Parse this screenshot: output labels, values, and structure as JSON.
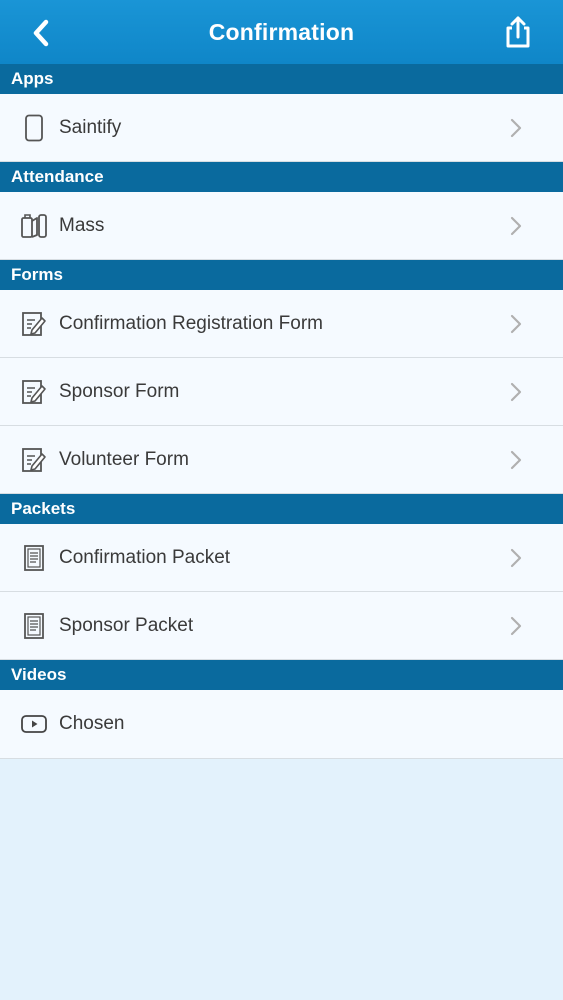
{
  "header": {
    "title": "Confirmation",
    "back_icon": "chevron-left-icon",
    "share_icon": "share-icon"
  },
  "sections": [
    {
      "title": "Apps",
      "items": [
        {
          "label": "Saintify",
          "icon": "phone-icon",
          "has_chevron": true
        }
      ]
    },
    {
      "title": "Attendance",
      "items": [
        {
          "label": "Mass",
          "icon": "attendance-icon",
          "has_chevron": true
        }
      ]
    },
    {
      "title": "Forms",
      "items": [
        {
          "label": "Confirmation Registration Form",
          "icon": "form-edit-icon",
          "has_chevron": true
        },
        {
          "label": "Sponsor Form",
          "icon": "form-edit-icon",
          "has_chevron": true
        },
        {
          "label": "Volunteer Form",
          "icon": "form-edit-icon",
          "has_chevron": true
        }
      ]
    },
    {
      "title": "Packets",
      "items": [
        {
          "label": "Confirmation Packet",
          "icon": "document-icon",
          "has_chevron": true
        },
        {
          "label": "Sponsor Packet",
          "icon": "document-icon",
          "has_chevron": true
        }
      ]
    },
    {
      "title": "Videos",
      "items": [
        {
          "label": "Chosen",
          "icon": "video-play-icon",
          "has_chevron": false
        }
      ]
    }
  ],
  "colors": {
    "header_bg": "#1a95d6",
    "section_bg": "#0a6a9e",
    "row_bg": "#f5faff",
    "page_bg": "#e3f2fc"
  }
}
